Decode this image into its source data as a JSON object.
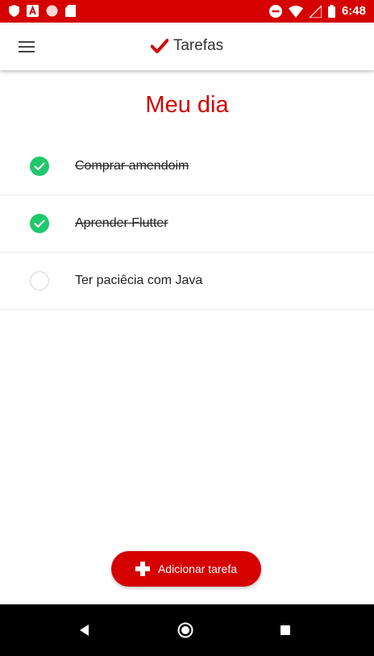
{
  "status_bar": {
    "time": "6:48",
    "background": "#d50000"
  },
  "app_bar": {
    "title": "Tarefas",
    "menu_icon": "hamburger-menu-icon",
    "title_icon": "checkmark-icon"
  },
  "page": {
    "title": "Meu dia"
  },
  "tasks": [
    {
      "label": "Comprar amendoim",
      "done": true
    },
    {
      "label": "Aprender Flutter",
      "done": true
    },
    {
      "label": "Ter paciêcia com Java",
      "done": false
    }
  ],
  "add_button": {
    "label": "Adicionar tarefa",
    "icon": "plus-icon"
  },
  "colors": {
    "accent": "#d50000",
    "done_check": "#1ec96b"
  }
}
